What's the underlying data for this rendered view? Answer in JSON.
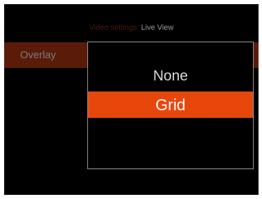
{
  "header": {
    "prefix": "Video settings:",
    "value": "Live View"
  },
  "setting": {
    "label": "Overlay"
  },
  "dropdown": {
    "options": [
      "None",
      "Grid"
    ],
    "selected": "Grid"
  },
  "colors": {
    "accent": "#e8470c",
    "row_highlight": "#5a1c08",
    "background": "#000000",
    "border": "#9c9c9c"
  }
}
